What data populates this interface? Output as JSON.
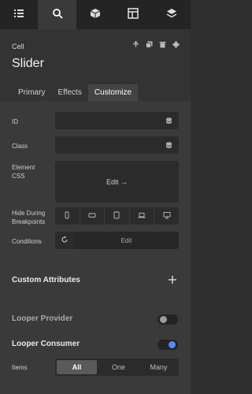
{
  "topbar": {
    "icons": [
      "list-icon",
      "search-icon",
      "cube-icon",
      "layout-icon",
      "layers-icon"
    ],
    "active_index": 1
  },
  "header": {
    "element_type": "Cell",
    "title": "Slider",
    "tools": [
      "arrow-up-icon",
      "copy-icon",
      "trash-icon",
      "gear-icon"
    ],
    "tabs": [
      "Primary",
      "Effects",
      "Customize"
    ],
    "active_tab": "Customize"
  },
  "fields": {
    "id_label": "ID",
    "class_label": "Class",
    "css_label_1": "Element",
    "css_label_2": "CSS",
    "css_edit": "Edit →",
    "hide_label_1": "Hide During",
    "hide_label_2": "Breakpoints",
    "breakpoints": [
      "phone-portrait-icon",
      "phone-landscape-icon",
      "tablet-icon",
      "laptop-icon",
      "desktop-icon"
    ],
    "conditions_label": "Conditions",
    "conditions_edit": "Edit"
  },
  "custom_attributes": {
    "title": "Custom Attributes"
  },
  "looper_provider": {
    "label": "Looper Provider",
    "enabled": false
  },
  "looper_consumer": {
    "label": "Looper Consumer",
    "enabled": true
  },
  "items": {
    "label": "Items",
    "options": [
      "All",
      "One",
      "Many"
    ],
    "selected": "All"
  },
  "colors": {
    "accent": "#4f8ef7"
  }
}
